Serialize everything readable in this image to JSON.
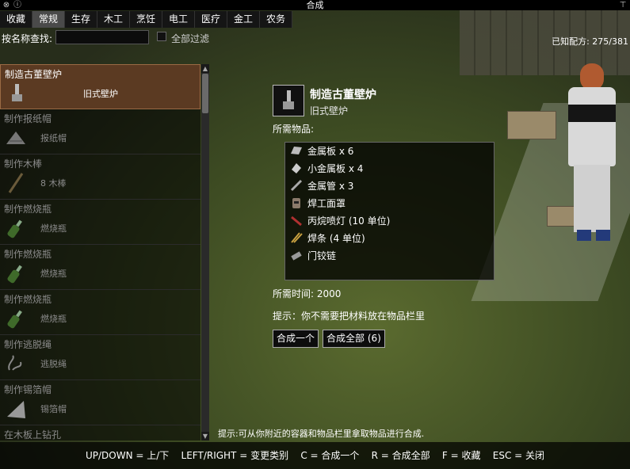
{
  "window": {
    "title": "合成"
  },
  "tabs": [
    {
      "label": "收藏"
    },
    {
      "label": "常规"
    },
    {
      "label": "生存"
    },
    {
      "label": "木工"
    },
    {
      "label": "烹饪"
    },
    {
      "label": "电工"
    },
    {
      "label": "医疗"
    },
    {
      "label": "金工"
    },
    {
      "label": "农务"
    }
  ],
  "search": {
    "label": "按名称查找:",
    "value": "",
    "placeholder": ""
  },
  "filter": {
    "label": "全部过滤"
  },
  "known": {
    "label": "已知配方:",
    "value": "275/381"
  },
  "recipes": [
    {
      "name": "制造古董壁炉",
      "sub": "旧式壁炉",
      "icon": "fireplace-icon"
    },
    {
      "name": "制作报纸帽",
      "sub": "报纸帽",
      "icon": "newspaper-hat-icon"
    },
    {
      "name": "制作木棒",
      "sub": "8 木棒",
      "icon": "stick-icon"
    },
    {
      "name": "制作燃烧瓶",
      "sub": "燃烧瓶",
      "icon": "bottle-icon"
    },
    {
      "name": "制作燃烧瓶",
      "sub": "燃烧瓶",
      "icon": "bottle-icon"
    },
    {
      "name": "制作燃烧瓶",
      "sub": "燃烧瓶",
      "icon": "bottle-icon"
    },
    {
      "name": "制作逃脱绳",
      "sub": "逃脱绳",
      "icon": "rope-icon"
    },
    {
      "name": "制作锡箔帽",
      "sub": "锡箔帽",
      "icon": "foil-hat-icon"
    },
    {
      "name": "在木板上钻孔",
      "sub": "",
      "icon": "plank-icon"
    }
  ],
  "detail": {
    "title": "制造古董壁炉",
    "subtitle": "旧式壁炉",
    "required_label": "所需物品:",
    "ingredients": [
      {
        "text": "金属板 x 6",
        "icon": "metal-sheet-icon"
      },
      {
        "text": "小金属板 x 4",
        "icon": "small-metal-sheet-icon"
      },
      {
        "text": "金属管 x 3",
        "icon": "metal-pipe-icon"
      },
      {
        "text": "焊工面罩",
        "icon": "welder-mask-icon"
      },
      {
        "text": "丙烷喷灯 (10 单位)",
        "icon": "blowtorch-icon"
      },
      {
        "text": "焊条 (4 单位)",
        "icon": "welding-rods-icon"
      },
      {
        "text": "门铰链",
        "icon": "hinge-icon"
      }
    ],
    "time_label": "所需时间: 2000",
    "hint": "提示：你不需要把材料放在物品栏里",
    "craft_one": "合成一个",
    "craft_all": "合成全部 (6)"
  },
  "bottom_hint": "提示:可从你附近的容器和物品栏里拿取物品进行合成.",
  "footer": "UP/DOWN = 上/下    LEFT/RIGHT = 变更类别    C = 合成一个    R = 合成全部    F = 收藏    ESC = 关闭",
  "colors": {
    "selected_row": "#5b3a22",
    "accent_border": "#9a6a44"
  }
}
